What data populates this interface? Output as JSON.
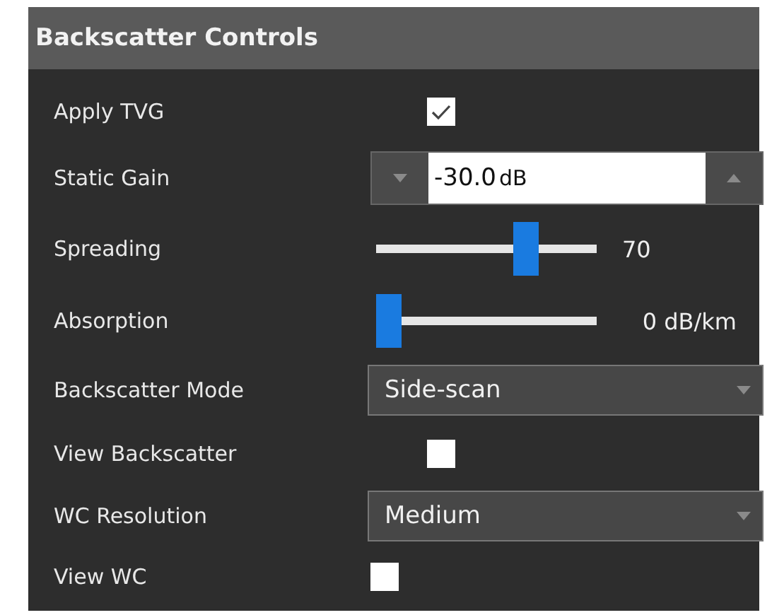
{
  "panel": {
    "title": "Backscatter Controls"
  },
  "rows": [
    {
      "kind": "checkbox",
      "label": "Apply TVG",
      "checked": true
    },
    {
      "kind": "spinner",
      "label": "Static Gain",
      "value": "-30.0",
      "unit": "dB"
    },
    {
      "kind": "slider",
      "label": "Spreading",
      "level": 0.7,
      "reading": "70"
    },
    {
      "kind": "slider",
      "label": "Absorption",
      "level": 0,
      "reading": "0 dB/km"
    },
    {
      "kind": "dropdown",
      "label": "Backscatter Mode",
      "value": "Side-scan"
    },
    {
      "kind": "checkbox",
      "label": "View Backscatter",
      "checked": false
    },
    {
      "kind": "dropdown",
      "label": "WC Resolution",
      "value": "Medium"
    },
    {
      "kind": "checkbox",
      "label": "View WC",
      "checked": false
    }
  ]
}
